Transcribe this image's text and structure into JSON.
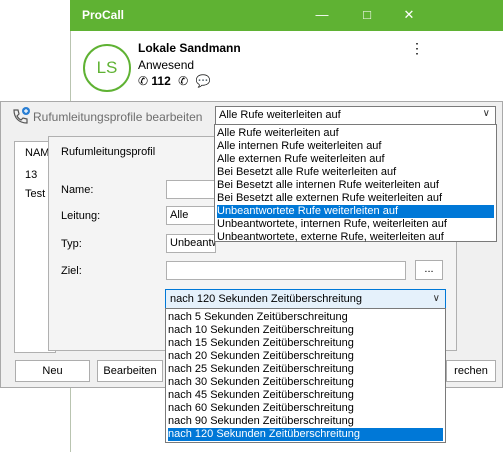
{
  "procall": {
    "title": "ProCall",
    "avatar_initials": "LS",
    "user_name": "Lokale Sandmann",
    "user_status": "Anwesend",
    "extension": "112"
  },
  "outer_dialog": {
    "title": "Rufumleitungsprofile bearbeiten",
    "selected_rule": "Alle Rufe weiterleiten auf",
    "list_header": "NAM",
    "list_rows": [
      "13",
      "Test"
    ],
    "buttons": {
      "new": "Neu",
      "edit": "Bearbeiten",
      "close_partial": "rechen"
    }
  },
  "rule_dropdown": {
    "items": [
      "Alle Rufe weiterleiten auf",
      "Alle internen Rufe weiterleiten auf",
      "Alle externen Rufe weiterleiten auf",
      "Bei Besetzt alle Rufe weiterleiten auf",
      "Bei Besetzt alle internen Rufe weiterleiten auf",
      "Bei Besetzt alle externen Rufe weiterleiten auf",
      "Unbeantwortete Rufe weiterleiten auf",
      "Unbeantwortete, internen Rufe, weiterleiten auf",
      "Unbeantwortete, externe Rufe, weiterleiten auf"
    ],
    "selected_index": 6
  },
  "profile_dialog": {
    "title": "Rufumleitungsprofil",
    "labels": {
      "name": "Name:",
      "line": "Leitung:",
      "type": "Typ:",
      "target": "Ziel:"
    },
    "name_value": "",
    "line_value": "Alle",
    "type_value": "Unbeantwortete Rufe weiterleiten auf",
    "target_value": "",
    "browse_label": "...",
    "timeout_value": "nach 120 Sekunden Zeitüberschreitung"
  },
  "timeout_dropdown": {
    "items": [
      "nach 5 Sekunden Zeitüberschreitung",
      "nach 10 Sekunden Zeitüberschreitung",
      "nach 15 Sekunden Zeitüberschreitung",
      "nach 20 Sekunden Zeitüberschreitung",
      "nach 25 Sekunden Zeitüberschreitung",
      "nach 30 Sekunden Zeitüberschreitung",
      "nach 45 Sekunden Zeitüberschreitung",
      "nach 60 Sekunden Zeitüberschreitung",
      "nach 90 Sekunden Zeitüberschreitung",
      "nach 120 Sekunden Zeitüberschreitung"
    ],
    "selected_index": 9
  }
}
